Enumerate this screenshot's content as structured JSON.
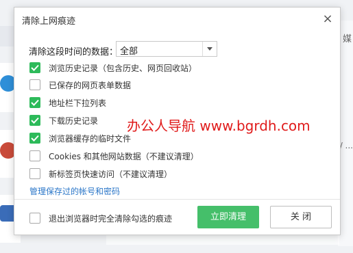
{
  "background": {
    "right_tab_text": "媒",
    "right_list_text": "/ ..."
  },
  "dialog": {
    "title": "清除上网痕迹",
    "close_glyph": "×",
    "range_label": "清除这段时间的数据：",
    "range_value": "全部",
    "options": [
      {
        "label": "浏览历史记录（包含历史、网页回收站）",
        "checked": true
      },
      {
        "label": "已保存的网页表单数据",
        "checked": false
      },
      {
        "label": "地址栏下拉列表",
        "checked": true
      },
      {
        "label": "下载历史记录",
        "checked": true
      },
      {
        "label": "浏览器缓存的临时文件",
        "checked": true
      },
      {
        "label": "Cookies 和其他网站数据（不建议清理）",
        "checked": false
      },
      {
        "label": "新标签页快速访问（不建议清理）",
        "checked": false
      }
    ],
    "manage_link": "管理保存过的帐号和密码",
    "exit_clear_label": "退出浏览器时完全清除勾选的痕迹",
    "exit_clear_checked": false,
    "clear_button": "立即清理",
    "close_button": "关 闭"
  },
  "watermark": "办公人导航 www.bgrdh.com",
  "colors": {
    "accent_green": "#45bf6a",
    "checkbox_green": "#2dba5a",
    "link_blue": "#2a76c8",
    "watermark_red": "#e01b1b"
  }
}
